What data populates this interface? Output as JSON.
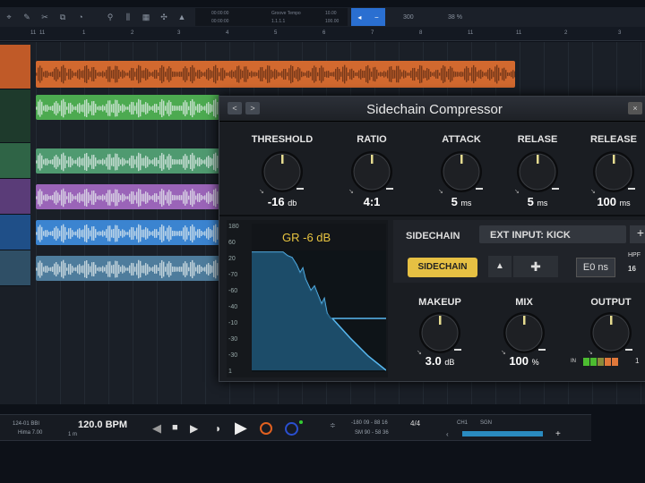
{
  "toolbar": {
    "lcd": {
      "r1": [
        "00:00:00",
        "Groove Tempo",
        "10.00"
      ],
      "r2": [
        "00:00:00",
        "1.1.1.1",
        "100.00"
      ]
    },
    "zoom": "300",
    "percent": "38 %"
  },
  "ruler": [
    "11",
    "11",
    "1",
    "2",
    "3",
    "4",
    "5",
    "6",
    "7",
    "8",
    "11",
    "11",
    "2",
    "3"
  ],
  "tracks": [
    {
      "color": "#d2692f"
    },
    {
      "color": "#4caa50"
    },
    {
      "color": "#4f9a70"
    },
    {
      "color": "#9a64b8"
    },
    {
      "color": "#3b84d0"
    },
    {
      "color": "#4e7c9c"
    }
  ],
  "plugin": {
    "title": "Sidechain Compressor",
    "prev": "<",
    "next": ">",
    "close": "×",
    "knobs": [
      {
        "label": "THRESHOLD",
        "value": "-16",
        "unit": "db"
      },
      {
        "label": "RATIO",
        "value": "4:1",
        "unit": ""
      },
      {
        "label": "ATTACK",
        "value": "5",
        "unit": "ms"
      },
      {
        "label": "RELASE",
        "value": "5",
        "unit": "ms"
      },
      {
        "label": "RELEASE",
        "value": "100",
        "unit": "ms"
      }
    ],
    "graph": {
      "gr_label": "GR -6 dB",
      "scale": [
        "180",
        "60",
        "20",
        "-70",
        "-60",
        "-40",
        "-10",
        "-30",
        "-30",
        "1"
      ]
    },
    "sidechain": {
      "label": "SIDECHAIN",
      "input": "EXT INPUT: KICK",
      "plus": "+",
      "toggle": "SIDECHAIN",
      "time": "E0 ns",
      "hpf": "HPF",
      "hpf_val": "16"
    },
    "knobs2": [
      {
        "label": "MAKEUP",
        "value": "3.0",
        "unit": "dB"
      },
      {
        "label": "MIX",
        "value": "100",
        "unit": "%"
      },
      {
        "label": "OUTPUT",
        "value": "",
        "unit": ""
      }
    ],
    "meter_in": "IN",
    "meter_out": "1"
  },
  "transport": {
    "pos1": "124-01 BBI",
    "pos2": "Hima 7.00",
    "tempo": "120.0 BPM",
    "tempo_sub": "1 m",
    "time1": "-180 09 - 88 16",
    "time2": "SM 90 - 58 36",
    "sig": "4/4",
    "ch": "CH1",
    "sel": "SGN",
    "add": "+"
  }
}
